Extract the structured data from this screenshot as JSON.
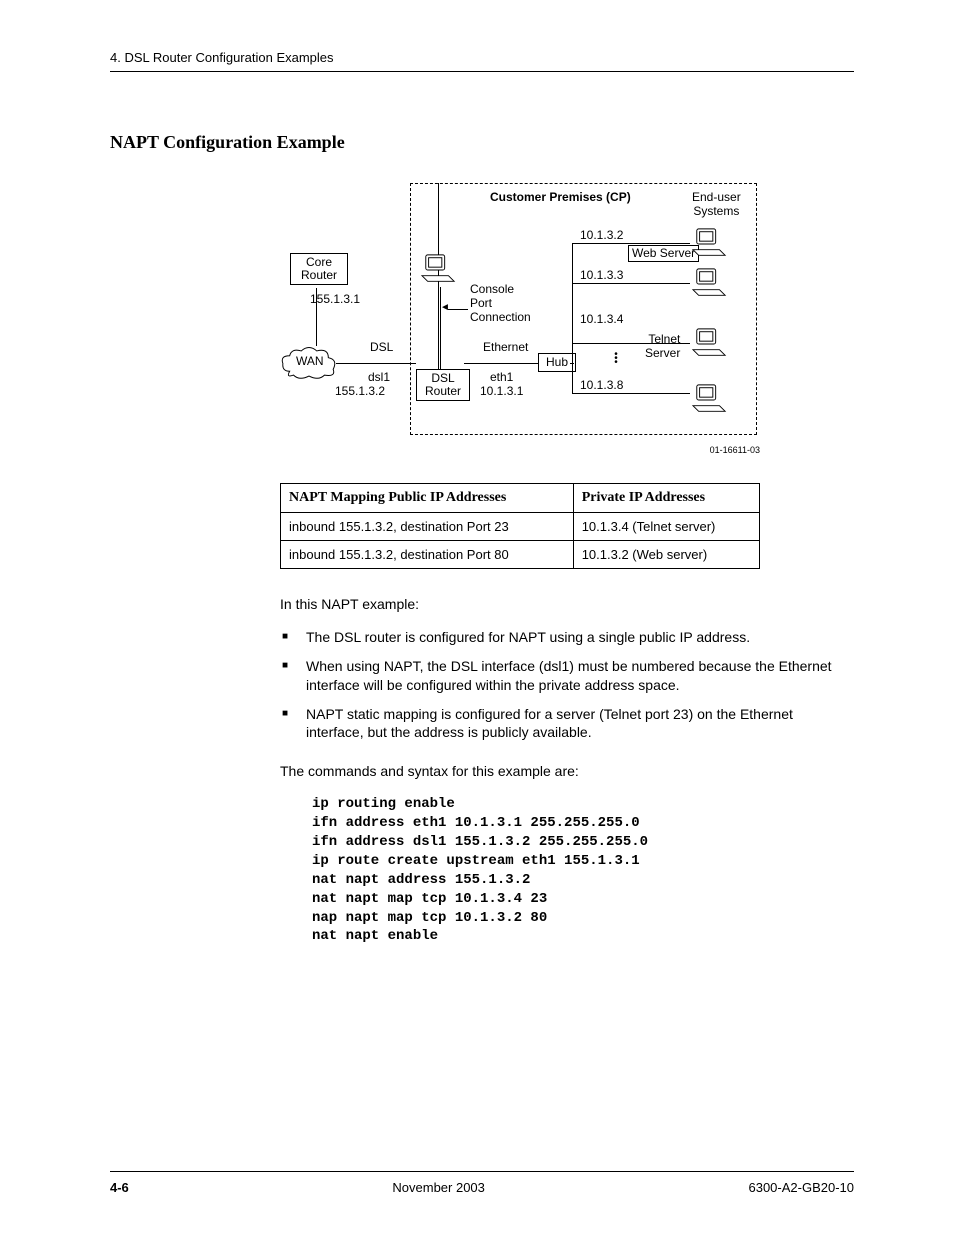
{
  "header": {
    "running": "4. DSL Router Configuration Examples"
  },
  "section": {
    "title": "NAPT Configuration Example"
  },
  "diagram": {
    "cp_title": "Customer Premises (CP)",
    "end_user": "End-user\nSystems",
    "core_router": "Core\nRouter",
    "core_ip": "155.1.3.1",
    "wan": "WAN",
    "dsl": "DSL",
    "dsl1": "dsl1",
    "dsl1_ip": "155.1.3.2",
    "dsl_router": "DSL\nRouter",
    "ethernet": "Ethernet",
    "eth1": "eth1",
    "eth1_ip": "10.1.3.1",
    "console": "Console\nPort\nConnection",
    "hub": "Hub",
    "ips": {
      "a": "10.1.3.2",
      "b": "10.1.3.3",
      "c": "10.1.3.4",
      "d": "10.1.3.8"
    },
    "web_server": "Web Server",
    "telnet_server": "Telnet\nServer",
    "id": "01-16611-03"
  },
  "table": {
    "head_public": "NAPT Mapping Public IP Addresses",
    "head_private": "Private IP Addresses",
    "rows": [
      {
        "pub": "inbound 155.1.3.2, destination Port 23",
        "priv": "10.1.3.4 (Telnet server)"
      },
      {
        "pub": "inbound 155.1.3.2, destination Port 80",
        "priv": "10.1.3.2 (Web server)"
      }
    ]
  },
  "body": {
    "intro": "In this NAPT example:",
    "bullets": [
      "The DSL router is configured for NAPT using a single public IP address.",
      "When using NAPT, the DSL interface (dsl1) must be numbered because the Ethernet interface will be configured within the private address space.",
      "NAPT static mapping is configured for a server (Telnet port 23) on the Ethernet interface, but the address is publicly available."
    ],
    "cmd_intro": "The commands and syntax for this example are:",
    "commands": "ip routing enable\nifn address eth1 10.1.3.1 255.255.255.0\nifn address dsl1 155.1.3.2 255.255.255.0\nip route create upstream eth1 155.1.3.1\nnat napt address 155.1.3.2\nnat napt map tcp 10.1.3.4 23\nnap napt map tcp 10.1.3.2 80\nnat napt enable"
  },
  "footer": {
    "page": "4-6",
    "date": "November 2003",
    "doc": "6300-A2-GB20-10"
  }
}
